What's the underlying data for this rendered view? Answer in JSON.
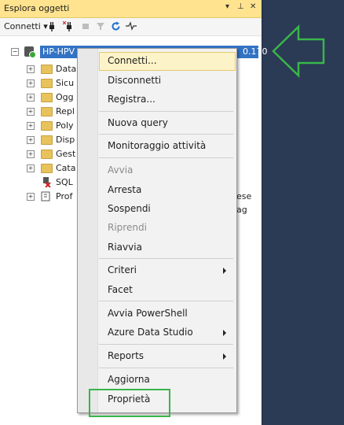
{
  "panel": {
    "title": "Esplora oggetti",
    "pin_glyph": "↓",
    "pin_icon2": "\u0001",
    "close_glyph": "✕"
  },
  "toolbar": {
    "connect_label": "Connetti ▾"
  },
  "tree": {
    "server_label": "HP-HPV",
    "server_suffix": "0.170",
    "nodes": [
      "Data",
      "Sicu",
      "Ogg",
      "Repl",
      "Poly",
      "Disp",
      "Gest",
      "Cata",
      "SQL",
      "Prof"
    ],
    "agent_suffix": "ese ag"
  },
  "menu": {
    "connect": "Connetti...",
    "disconnect": "Disconnetti",
    "register": "Registra...",
    "new_query": "Nuova query",
    "activity_monitor": "Monitoraggio attività",
    "start": "Avvia",
    "stop": "Arresta",
    "pause": "Sospendi",
    "resume": "Riprendi",
    "restart": "Riavvia",
    "policies": "Criteri",
    "facets": "Facet",
    "powershell": "Avvia PowerShell",
    "azure": "Azure Data Studio",
    "reports": "Reports",
    "refresh": "Aggiorna",
    "properties": "Proprietà"
  },
  "colors": {
    "accent": "#3373c4",
    "title_bar": "#ffe38f",
    "highlight_green": "#39b54a"
  }
}
